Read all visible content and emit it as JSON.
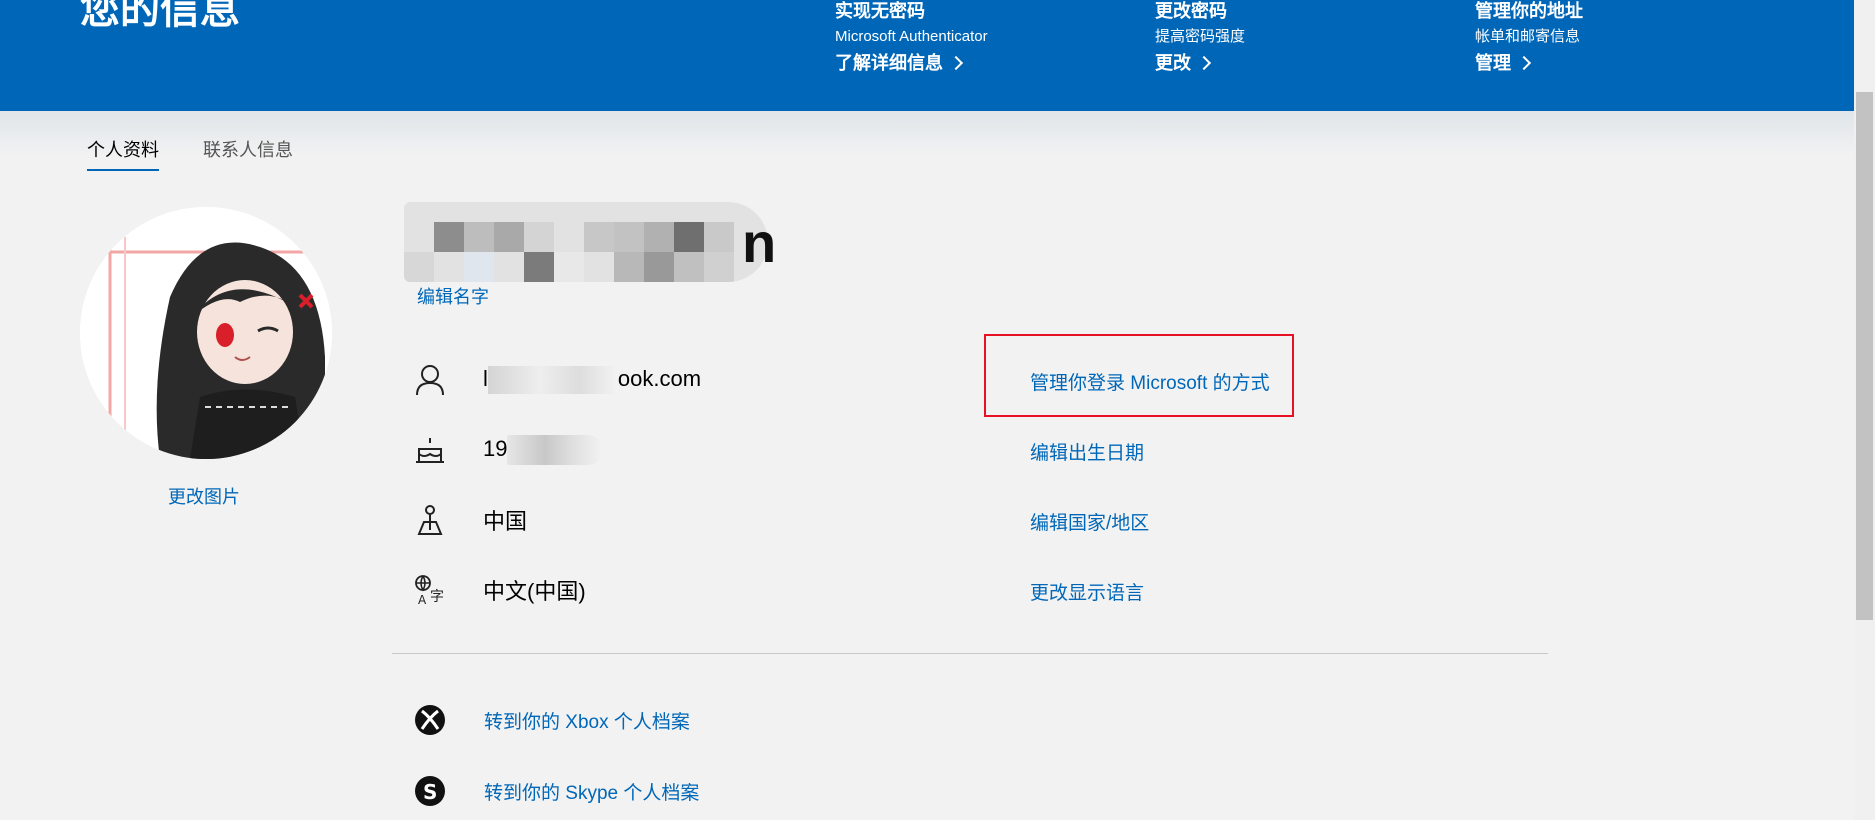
{
  "header": {
    "title": "您的信息",
    "promos": [
      {
        "title": "实现无密码",
        "subtitle": "Microsoft Authenticator",
        "link": "了解详细信息"
      },
      {
        "title": "更改密码",
        "subtitle": "提高密码强度",
        "link": "更改"
      },
      {
        "title": "管理你的地址",
        "subtitle": "帐单和邮寄信息",
        "link": "管理"
      }
    ]
  },
  "tabs": [
    "个人资料",
    "联系人信息"
  ],
  "profile": {
    "change_photo": "更改图片",
    "name_visible_tail": "n",
    "edit_name": "编辑名字"
  },
  "info_rows": [
    {
      "icon": "person-icon",
      "value_prefix": "l",
      "value_suffix": "ook.com",
      "action": "管理你登录 Microsoft 的方式"
    },
    {
      "icon": "birthday-cake-icon",
      "value_prefix": "19",
      "value_suffix": "",
      "action": "编辑出生日期"
    },
    {
      "icon": "location-pin-icon",
      "value_prefix": "中国",
      "value_suffix": "",
      "action": "编辑国家/地区"
    },
    {
      "icon": "language-icon",
      "value_prefix": "中文(中国)",
      "value_suffix": "",
      "action": "更改显示语言"
    }
  ],
  "profile_links": [
    {
      "icon": "xbox-icon",
      "label": "转到你的 Xbox 个人档案"
    },
    {
      "icon": "skype-icon",
      "label": "转到你的 Skype 个人档案"
    }
  ],
  "colors": {
    "header_bg": "#0067b8",
    "link": "#0067b8",
    "highlight": "#e81123"
  }
}
